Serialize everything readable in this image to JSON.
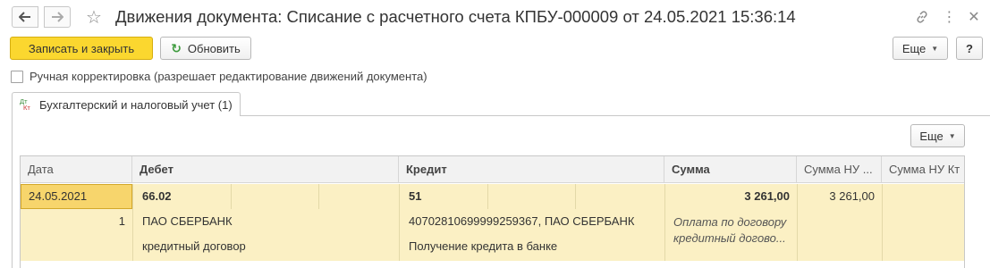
{
  "window": {
    "title": "Движения документа: Списание с расчетного счета КПБУ-000009 от 24.05.2021 15:36:14"
  },
  "toolbar": {
    "save_close_label": "Записать и закрыть",
    "refresh_label": "Обновить",
    "more_label": "Еще",
    "help_label": "?"
  },
  "manual_correction": {
    "label": "Ручная корректировка (разрешает редактирование движений документа)",
    "checked": false
  },
  "tabs": [
    {
      "label": "Бухгалтерский и налоговый учет (1)",
      "icon_top": "Дт",
      "icon_bottom": "Кт"
    }
  ],
  "grid_toolbar": {
    "more_label": "Еще"
  },
  "grid": {
    "columns": [
      "Дата",
      "Дебет",
      "Кредит",
      "Сумма",
      "Сумма НУ ...",
      "Сумма НУ Кт"
    ],
    "rows": [
      {
        "date": "24.05.2021",
        "number": "1",
        "debit_account": "66.02",
        "debit_sub1": "ПАО СБЕРБАНК",
        "debit_sub2": "кредитный договор",
        "credit_account": "51",
        "credit_sub1": "40702810699999259367, ПАО СБЕРБАНК",
        "credit_sub2": "Получение кредита в банке",
        "amount": "3 261,00",
        "content": "Оплата по договору кредитный догово...",
        "amount_nu_dt": "3 261,00",
        "amount_nu_kt": ""
      }
    ]
  },
  "colors": {
    "primary_button": "#fbd72f",
    "selected_row": "#fbf0c4",
    "selected_cell": "#f7d56c"
  }
}
